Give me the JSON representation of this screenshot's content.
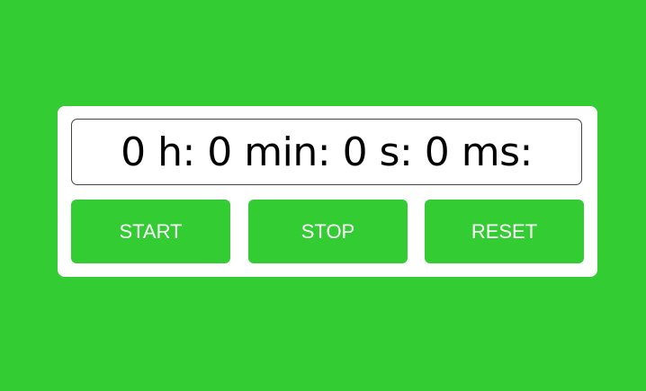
{
  "stopwatch": {
    "display": "0 h: 0 min: 0 s: 0 ms:"
  },
  "controls": {
    "start_label": "START",
    "stop_label": "STOP",
    "reset_label": "RESET"
  },
  "colors": {
    "background": "#33cc33",
    "card": "#ffffff",
    "button": "#33cc33",
    "button_text": "#ffffff",
    "display_text": "#000000"
  }
}
